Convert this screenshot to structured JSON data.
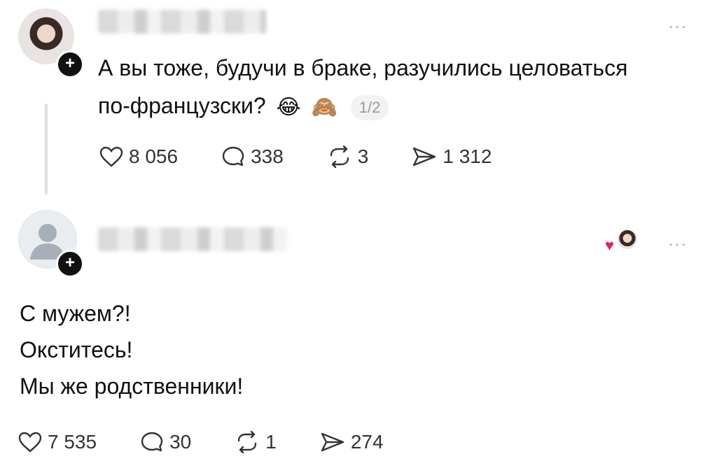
{
  "post": {
    "text_line1": "А вы тоже, будучи в браке, разучились целоваться",
    "text_line2": "по-французски?",
    "emoji1": "😂",
    "emoji2": "🙈",
    "page_badge": "1/2",
    "more": "...",
    "stats": {
      "likes": "8 056",
      "comments": "338",
      "reposts": "3",
      "shares": "1 312"
    }
  },
  "reply": {
    "lines": [
      "С мужем?!",
      "Окститесь!",
      "Мы же родственники!"
    ],
    "more": "...",
    "stats": {
      "likes": "7 535",
      "comments": "30",
      "reposts": "1",
      "shares": "274"
    }
  },
  "icons": {
    "plus": "+",
    "heart_mini": "♥"
  }
}
